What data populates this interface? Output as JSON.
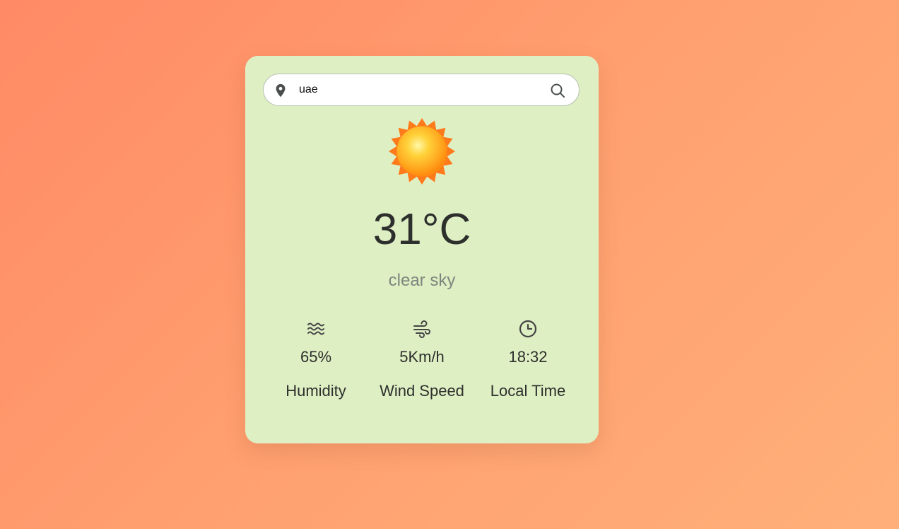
{
  "search": {
    "value": "uae",
    "icon": "location-pin-icon",
    "button_icon": "search-icon"
  },
  "weather": {
    "icon": "sun-icon",
    "temperature": "31°C",
    "description": "clear sky"
  },
  "stats": [
    {
      "icon": "humidity-waves-icon",
      "value": "65%",
      "label": "Humidity"
    },
    {
      "icon": "wind-icon",
      "value": "5Km/h",
      "label": "Wind Speed"
    },
    {
      "icon": "clock-icon",
      "value": "18:32",
      "label": "Local Time"
    }
  ],
  "colors": {
    "card": "#dfefc4",
    "background_start": "#ff8a65",
    "background_end": "#ffb07a",
    "text_dark": "#2d2f2c",
    "text_muted": "#7e857d"
  }
}
